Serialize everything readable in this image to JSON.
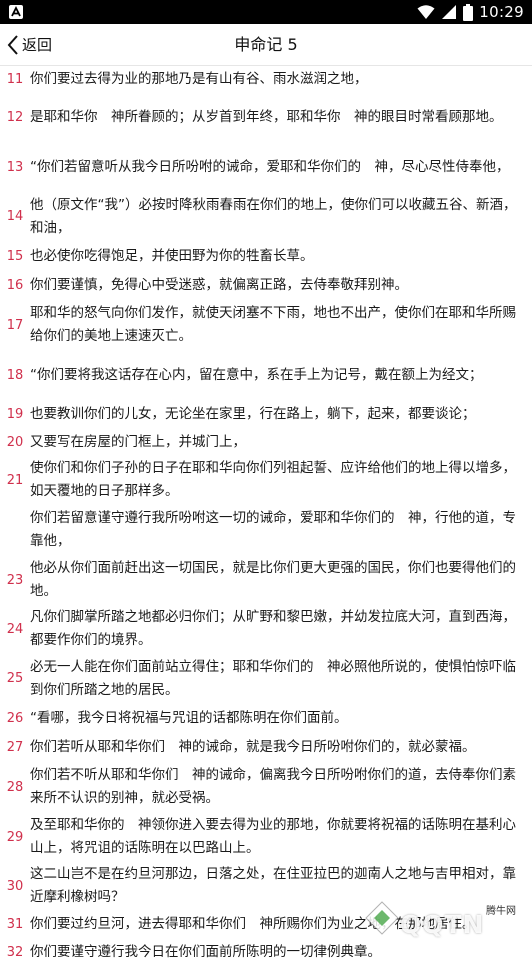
{
  "status_bar": {
    "time": "10:29",
    "left_icon": "android-notification-icon",
    "icons": [
      "wifi-icon",
      "signal-icon",
      "battery-icon"
    ]
  },
  "header": {
    "back_label": "返回",
    "title": "申命记 5"
  },
  "verses": [
    {
      "num": "11",
      "text": "你们要过去得为业的那地乃是有山有谷、雨水滋润之地，"
    },
    {
      "num": "12",
      "text": "是耶和华你　神所眷顾的；从岁首到年终，耶和华你　神的眼目时常看顾那地。"
    },
    {
      "num": "13",
      "text": "“你们若留意听从我今日所吩咐的诫命，爱耶和华你们的　神，尽心尽性侍奉他，"
    },
    {
      "num": "14",
      "text": "他（原文作“我”）必按时降秋雨春雨在你们的地上，使你们可以收藏五谷、新酒，和油，"
    },
    {
      "num": "15",
      "text": "也必使你吃得饱足，并使田野为你的牲畜长草。"
    },
    {
      "num": "16",
      "text": "你们要谨慎，免得心中受迷惑，就偏离正路，去侍奉敬拜别神。"
    },
    {
      "num": "17",
      "text": "耶和华的怒气向你们发作，就使天闭塞不下雨，地也不出产，使你们在耶和华所赐给你们的美地上速速灭亡。"
    },
    {
      "num": "18",
      "text": "“你们要将我这话存在心内，留在意中，系在手上为记号，戴在额上为经文；"
    },
    {
      "num": "19",
      "text": "也要教训你们的儿女，无论坐在家里，行在路上，躺下，起来，都要谈论；"
    },
    {
      "num": "20",
      "text": "又要写在房屋的门框上，并城门上，"
    },
    {
      "num": "21",
      "text": "使你们和你们子孙的日子在耶和华向你们列祖起誓、应许给他们的地上得以增多，如天覆地的日子那样多。"
    },
    {
      "num": "",
      "text": "你们若留意谨守遵行我所吩咐这一切的诫命，爱耶和华你们的　神，行他的道，专靠他，"
    },
    {
      "num": "23",
      "text": "他必从你们面前赶出这一切国民，就是比你们更大更强的国民，你们也要得他们的地。"
    },
    {
      "num": "24",
      "text": "凡你们脚掌所踏之地都必归你们；从旷野和黎巴嫩，并幼发拉底大河，直到西海，都要作你们的境界。"
    },
    {
      "num": "25",
      "text": "必无一人能在你们面前站立得住；耶和华你们的　神必照他所说的，使惧怕惊吓临到你们所踏之地的居民。"
    },
    {
      "num": "26",
      "text": "“看哪，我今日将祝福与咒诅的话都陈明在你们面前。"
    },
    {
      "num": "27",
      "text": "你们若听从耶和华你们　神的诫命，就是我今日所吩咐你们的，就必蒙福。"
    },
    {
      "num": "28",
      "text": "你们若不听从耶和华你们　神的诫命，偏离我今日所吩咐你们的道，去侍奉你们素来所不认识的别神，就必受祸。"
    },
    {
      "num": "29",
      "text": "及至耶和华你的　神领你进入要去得为业的那地，你就要将祝福的话陈明在基利心山上，将咒诅的话陈明在以巴路山上。"
    },
    {
      "num": "30",
      "text": "这二山岂不是在约旦河那边，日落之处，在住亚拉巴的迦南人之地与吉甲相对，靠近摩利橡树吗？"
    },
    {
      "num": "31",
      "text": "你们要过约旦河，进去得耶和华你们　神所赐你们为业之地，在那地居住。"
    },
    {
      "num": "32",
      "text": "你们要谨守遵行我今日在你们面前所陈明的一切律例典章。"
    }
  ],
  "watermark": {
    "brand": "QQTN",
    "small": "腾牛网"
  }
}
